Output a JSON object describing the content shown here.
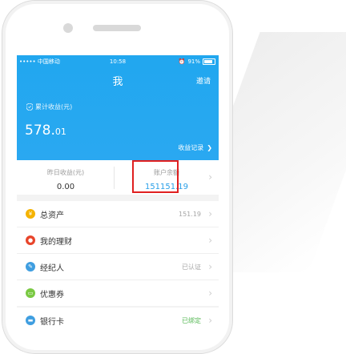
{
  "status_bar": {
    "carrier": "••••• 中国移动",
    "time": "10:58",
    "battery": "91%"
  },
  "header": {
    "title": "我",
    "invite_label": "邀请",
    "cumulative_label": "累计收益(元)",
    "cumulative_int": "578.",
    "cumulative_dec": "01",
    "income_record_label": "收益记录"
  },
  "balances": {
    "yesterday_label": "昨日收益(元)",
    "yesterday_value": "0.00",
    "account_label": "账户余额",
    "account_value": "151151.19"
  },
  "menu": {
    "items": [
      {
        "label": "总资产",
        "value": "151.19",
        "icon": "gold-coin-icon",
        "color": "#f5b300"
      },
      {
        "label": "我的理财",
        "value": "",
        "icon": "money-bag-icon",
        "color": "#e8452b"
      },
      {
        "label": "经纪人",
        "value": "已认证",
        "icon": "broker-icon",
        "color": "#3f9ee0"
      },
      {
        "label": "优惠券",
        "value": "",
        "icon": "coupon-icon",
        "color": "#7ac943"
      }
    ],
    "bank": {
      "label": "银行卡",
      "value": "已绑定",
      "icon": "bank-card-icon",
      "color": "#3f9ee0"
    }
  }
}
